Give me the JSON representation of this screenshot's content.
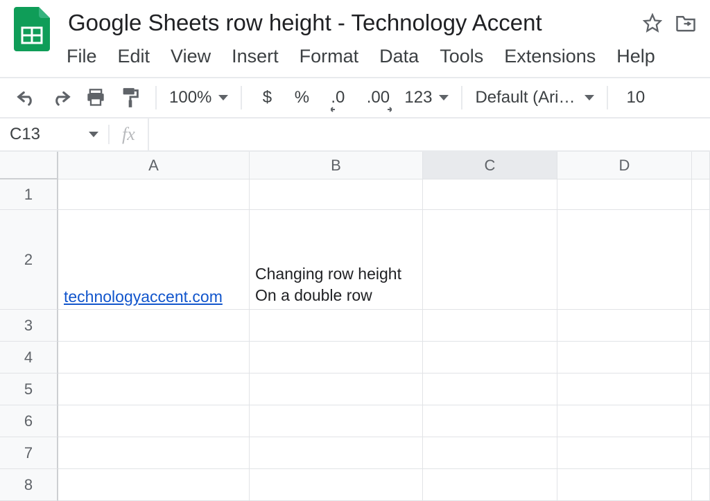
{
  "doc": {
    "title": "Google Sheets row height - Technology Accent"
  },
  "menu": {
    "file": "File",
    "edit": "Edit",
    "view": "View",
    "insert": "Insert",
    "format": "Format",
    "data": "Data",
    "tools": "Tools",
    "extensions": "Extensions",
    "help": "Help"
  },
  "toolbar": {
    "zoom": "100%",
    "currency": "$",
    "percent": "%",
    "dec_dec": ".0",
    "inc_dec": ".00",
    "more_formats": "123",
    "font": "Default (Ari…",
    "font_size": "10"
  },
  "formula": {
    "name_box": "C13",
    "fx": "fx",
    "value": ""
  },
  "columns": [
    "A",
    "B",
    "C",
    "D"
  ],
  "rows": [
    "1",
    "2",
    "3",
    "4",
    "5",
    "6",
    "7",
    "8"
  ],
  "cells": {
    "A2": "technologyaccent.com",
    "B2": "Changing row height\nOn a double row"
  }
}
